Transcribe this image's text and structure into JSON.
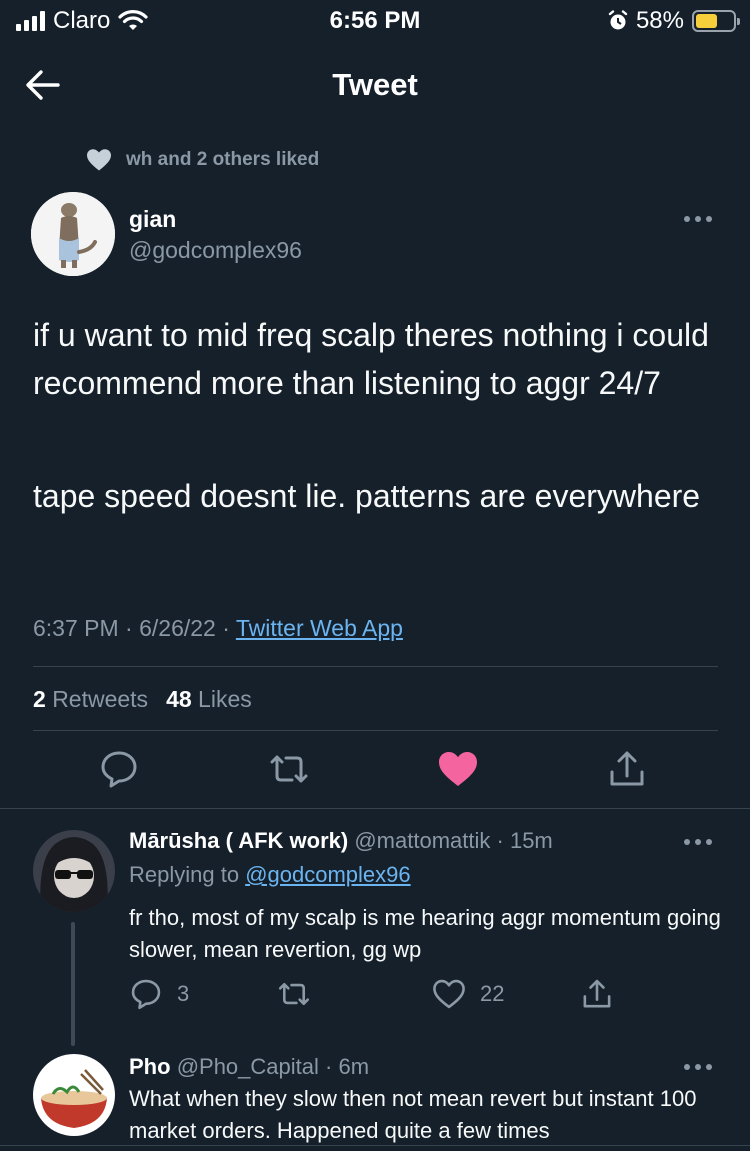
{
  "status_bar": {
    "carrier": "Claro",
    "time": "6:56 PM",
    "battery_percent": "58%",
    "battery_level": 0.58
  },
  "header": {
    "title": "Tweet"
  },
  "social_context": "wh and 2 others liked",
  "tweet": {
    "author_name": "gian",
    "author_handle": "@godcomplex96",
    "paragraph_1": "if u want to mid freq scalp theres nothing i could recommend more than listening to aggr 24/7",
    "paragraph_2": "tape speed doesnt lie. patterns are everywhere",
    "time": "6:37 PM",
    "date": "6/26/22",
    "source": "Twitter Web App",
    "retweet_count": "2",
    "retweet_label": "Retweets",
    "like_count": "48",
    "like_label": "Likes"
  },
  "replies": [
    {
      "name": "Mārūsha ( AFK work)",
      "handle": "@mattomattik",
      "age": "15m",
      "replying_to_label": "Replying to",
      "replying_to_handle": "@godcomplex96",
      "text": "fr tho, most of my scalp is me hearing aggr momentum going slower, mean revertion, gg wp",
      "reply_count": "3",
      "like_count": "22"
    },
    {
      "name": "Pho",
      "handle": "@Pho_Capital",
      "age": "6m",
      "text": "What when they slow then not mean revert but instant 100 market orders. Happened quite a few times"
    }
  ],
  "colors": {
    "background": "#15202b",
    "muted": "#8b98a5",
    "link": "#6cb4f0",
    "like_active": "#f4649e",
    "divider": "#38444d"
  }
}
